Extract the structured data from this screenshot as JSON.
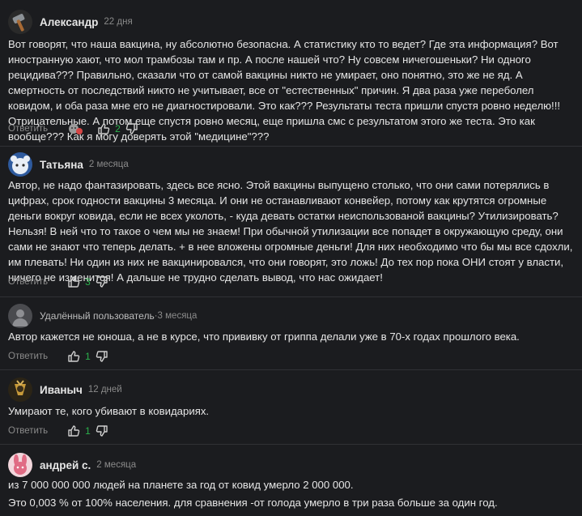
{
  "reply_label": "Ответить",
  "comments": [
    {
      "author": "Александр",
      "time": "22 дня",
      "text": "Вот говорят, что наша вакцина, ну абсолютно безопасна. А статистику кто то ведет? Где эта информация? Вот иностранную хают, что мол трамбозы там и пр. А после нашей что? Ну совсем ничегошеньки? Ни одного рецидива??? Правильно, сказали что от самой вакцины никто не умирает, оно понятно, это же не яд. А смертность от последствий никто не учитывает, все от \"естественных\" причин. Я два раза уже переболел ковидом, и оба раза мне его не диагностировали. Это как??? Результаты теста пришли спустя ровно неделю!!! Отрицательные. А потом еще спустя ровно месяц, еще пришла смс с результатом этого же теста. Это как вообще??? Как я могу доверять этой \"медицине\"???",
      "likes": "2",
      "has_reaction": true
    },
    {
      "author": "Татьяна",
      "time": "2 месяца",
      "text": "Автор, не надо фантазировать, здесь все ясно. Этой вакцины выпущено столько, что они сами потерялись в цифрах, срок годности вакцины 3 месяца. И они не останавливают конвейер, потому как крутятся огромные деньги вокруг ковида, если не всех уколоть, - куда девать остатки неиспользованой вакцины? Утилизировать? Нельзя! В ней что то такое о чем мы не знаем! При обычной утилизации все попадет в окружающую среду, они сами не знают что теперь делать. + в нее вложены огромные деньги! Для них необходимо что бы мы все сдохли, им плевать! Ни один из них не вакцинировался, что они говорят, это ложь! До тех пор пока ОНИ стоят у власти, ничего не изменится! А дальше не трудно сделать вывод, что нас ожидает!",
      "likes": "3"
    },
    {
      "author": "Удалённый пользователь",
      "time": "3 месяца",
      "separator": " · ",
      "text": "Автор кажется не юноша, а не в курсе, что прививку от гриппа делали уже в 70-х годах прошлого века.",
      "likes": "1"
    },
    {
      "author": "Иваныч",
      "time": "12 дней",
      "text": "Умирают те, кого убивают в ковидариях.",
      "likes": "1"
    },
    {
      "author": "андрей с.",
      "time": "2 месяца",
      "text_lines": [
        "из 7 000 000 000 людей на планете за год от ковид умерло 2 000 000.",
        "Это 0,003 % от 100% населения. для сравнения -от голода умерло в три раза больше за один год."
      ]
    }
  ],
  "colors": {
    "background": "#1b1c1f",
    "text": "#e6e6e6",
    "muted": "#8a8a8a",
    "like_count": "#2bb24c"
  }
}
